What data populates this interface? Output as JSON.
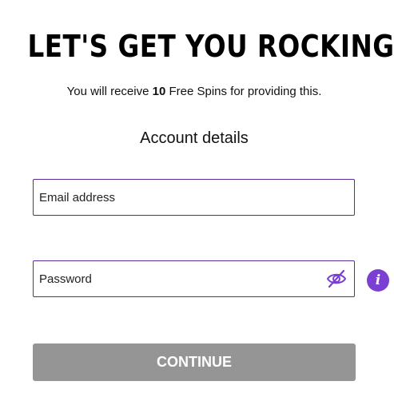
{
  "header": {
    "title": "LET'S GET YOU ROCKING!",
    "subtitle_before": "You will receive ",
    "subtitle_bold": "10",
    "subtitle_after": " Free Spins for providing this."
  },
  "section": {
    "title": "Account details"
  },
  "form": {
    "email": {
      "placeholder": "Email address",
      "value": ""
    },
    "password": {
      "placeholder": "Password",
      "value": ""
    },
    "continue_label": "CONTINUE"
  },
  "icons": {
    "password_toggle": "eye-slash-icon",
    "info": "info-icon",
    "info_glyph": "i"
  },
  "colors": {
    "accent": "#7b3fd1",
    "field_border": "#5a2a9a",
    "button_disabled": "#959595"
  }
}
